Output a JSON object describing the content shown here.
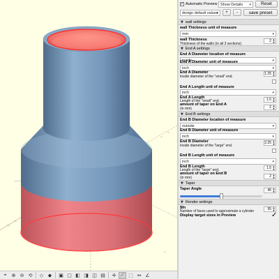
{
  "toolbar": {
    "auto_preview_label": "Automatic Preview",
    "auto_preview_checked": true,
    "show_details_label": "Show Details",
    "reset_label": "Reset",
    "preset_value": "design default values",
    "add_label": "+",
    "remove_label": "-",
    "save_preset_label": "save preset"
  },
  "sections": {
    "wall": "wall settings",
    "end_a": "End A settings",
    "end_b": "End B settings",
    "taper": "Taper",
    "render": "Render settings"
  },
  "params": {
    "wall_unit": {
      "label": "wall Thickness unit of measure",
      "value": "mm"
    },
    "wall_thickness": {
      "label": "wall Thickness",
      "desc": "Thickness of the walls (in all 3 sections).",
      "value": "2"
    },
    "a_diam_loc": {
      "label": "End A Diameter location of measure",
      "value": "inside"
    },
    "a_diam_unit": {
      "label": "End A Diameter unit of measure",
      "value": "inch"
    },
    "a_diam": {
      "label": "End A Diameter",
      "desc": "Inside diameter of the \"small\" end.",
      "value": "1.25"
    },
    "a_len_unit": {
      "label": "End A Length unit of measure",
      "value": "inch"
    },
    "a_len": {
      "label": "End A Length",
      "desc": "Length of the \"small\" end.",
      "value": "1.5"
    },
    "a_taper": {
      "label": "amount of taper on End A",
      "desc": "(in mm)",
      "value": "2"
    },
    "b_diam_loc": {
      "label": "End B Diameter location of measure",
      "value": "outside"
    },
    "b_diam_unit": {
      "label": "End B Diameter unit of measure",
      "value": "inch"
    },
    "b_diam": {
      "label": "End B Diameter",
      "desc": "Inside diameter of the \"large\" end.",
      "value": "2.25"
    },
    "b_len_unit": {
      "label": "End B Length unit of measure",
      "value": "inch"
    },
    "b_len": {
      "label": "End B Length",
      "desc": "Length of the \"large\" end.",
      "value": "1.5"
    },
    "b_taper": {
      "label": "amount of taper on End B",
      "desc": "(in mm)",
      "value": "2"
    },
    "taper_angle": {
      "label": "Taper Angle",
      "value": "45",
      "fraction": 0.5
    },
    "fn": {
      "label": "$fn",
      "desc": "Number of faces used to approximate a cylinder",
      "value": "55"
    },
    "display_target": {
      "label": "Display target sizes in Preview",
      "checked": true
    }
  },
  "colors": {
    "viewport_bg": "#ffffe6",
    "body_blue": "#88a8c8",
    "highlight_red": "#ff6a6a",
    "accent_blue": "#3d7bd8"
  },
  "view_toolbar_icons": [
    "view-all-icon",
    "zoom-in-icon",
    "zoom-out-icon",
    "reset-view-icon",
    "perspective-icon",
    "orthogonal-icon",
    "view-top-icon",
    "view-bottom-icon",
    "view-left-icon",
    "view-right-icon",
    "view-front-icon",
    "view-back-icon",
    "show-axes-icon",
    "show-scales-icon",
    "show-edges-icon",
    "measure-distance-icon",
    "measure-angle-icon"
  ]
}
